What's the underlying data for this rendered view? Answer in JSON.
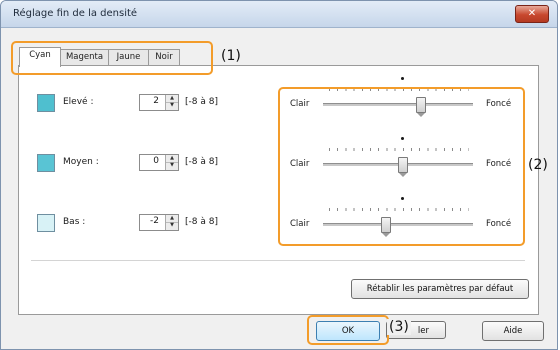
{
  "window": {
    "title": "Réglage fin de la densité",
    "close_label": "✕"
  },
  "tabs": [
    {
      "label": "Cyan",
      "active": true
    },
    {
      "label": "Magenta",
      "active": false
    },
    {
      "label": "Jaune",
      "active": false
    },
    {
      "label": "Noir",
      "active": false
    }
  ],
  "levels": [
    {
      "label": "Elevé :",
      "value": "2",
      "range": "[-8 à 8]",
      "swatch_color": "#4fbfcf",
      "slider_value": 2
    },
    {
      "label": "Moyen :",
      "value": "0",
      "range": "[-8 à 8]",
      "swatch_color": "#59c4d4",
      "slider_value": 0
    },
    {
      "label": "Bas :",
      "value": "-2",
      "range": "[-8 à 8]",
      "swatch_color": "#d8f2f6",
      "slider_value": -2
    }
  ],
  "slider": {
    "min": -8,
    "max": 8,
    "left_label": "Clair",
    "right_label": "Foncé"
  },
  "buttons": {
    "reset": "Rétablir les paramètres par défaut",
    "ok": "OK",
    "cancel": "ler",
    "help": "Aide"
  },
  "callouts": {
    "one": "(1)",
    "two": "(2)",
    "three": "(3)"
  },
  "colors": {
    "callout": "#f39c2a",
    "ok_button": "#bee6fd"
  }
}
